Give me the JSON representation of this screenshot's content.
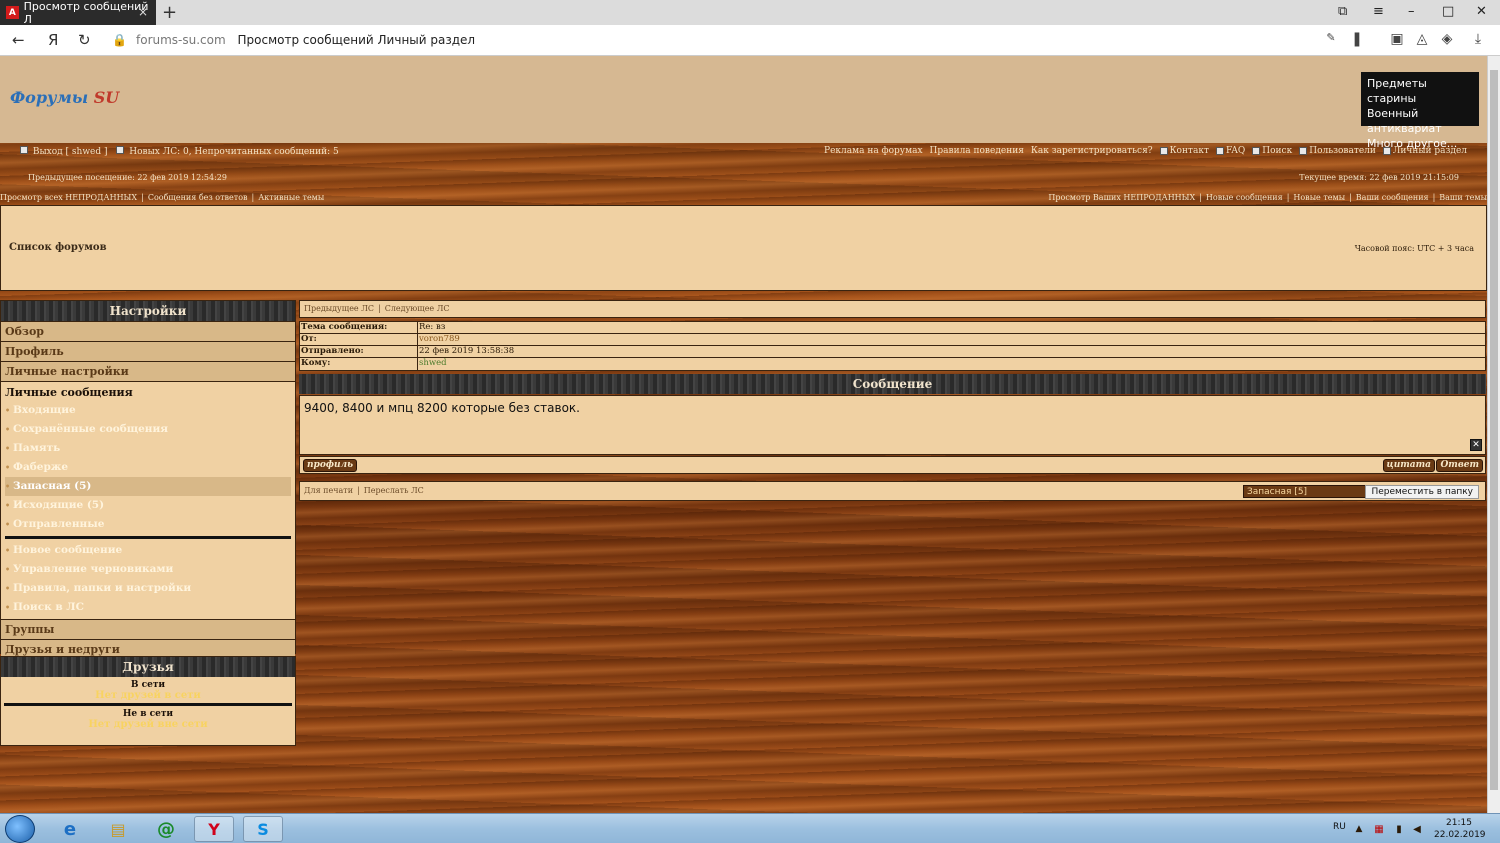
{
  "browser": {
    "tab_title": "Просмотр сообщений Л",
    "tab_favicon": "А",
    "tab_close": "×",
    "new_tab": "+",
    "domain": "forums-su.com",
    "page_title": "Просмотр сообщений Личный раздел"
  },
  "header": {
    "logo_main": "Форумы",
    "logo_su": "SU",
    "ad_lines": [
      "Предметы старины",
      "Военный антиквариат",
      "Много другое..."
    ]
  },
  "topbar": {
    "userbar": "Выход [ shwed ]",
    "pm_status": "Новых ЛС: 0, Непрочитанных сообщений: 5",
    "links": [
      "Реклама на форумах",
      "Правила поведения",
      "Как зарегистрироваться?",
      "Контакт",
      "FAQ",
      "Поиск",
      "Пользователи",
      "Личный раздел"
    ],
    "last_visit": "Предыдущее посещение: 22 фев 2019 12:54:29",
    "current_time": "Текущее время: 22 фев 2019 21:15:09",
    "sub_left": [
      "Просмотр всех НЕПРОДАННЫХ",
      "Сообщения без ответов",
      "Активные темы"
    ],
    "sub_right": [
      "Просмотр Ваших НЕПРОДАННЫХ",
      "Новые сообщения",
      "Новые темы",
      "Ваши сообщения",
      "Ваши темы"
    ]
  },
  "nav": {
    "forum_list": "Список форумов",
    "timezone": "Часовой пояс: UTC + 3 часа"
  },
  "settings": {
    "title": "Настройки",
    "items": [
      "Обзор",
      "Профиль",
      "Личные настройки"
    ],
    "pm_title": "Личные сообщения",
    "pm_folders": [
      "Входящие",
      "Сохранённые сообщения",
      "Память",
      "Фаберже",
      "Запасная (5)",
      "Исходящие (5)",
      "Отправленные"
    ],
    "pm_actions": [
      "Новое сообщение",
      "Управление черновиками",
      "Правила, папки и настройки",
      "Поиск в ЛС"
    ],
    "bottom_items": [
      "Группы",
      "Друзья и недруги"
    ]
  },
  "friends": {
    "title": "Друзья",
    "online_title": "В сети",
    "online_none": "Нет друзей в сети",
    "offline_title": "Не в сети",
    "offline_none": "Нет друзей вне сети"
  },
  "message": {
    "nav_prev": "Предыдущее ЛС",
    "nav_next": "Следующее ЛС",
    "subject_label": "Тема сообщения:",
    "subject": "Re: вз",
    "from_label": "От:",
    "from": "voron789",
    "sent_label": "Отправлено:",
    "sent": "22 фев 2019 13:58:38",
    "to_label": "Кому:",
    "to": "shwed",
    "header": "Сообщение",
    "body": "9400, 8400 и мпц 8200 которые без ставок.",
    "profile_btn": "профиль",
    "quote_btn": "цитата",
    "reply_btn": "Ответ",
    "print_link": "Для печати",
    "forward_link": "Переслать ЛС",
    "folder_selected": "Запасная [5]",
    "move_btn": "Переместить в папку"
  },
  "taskbar": {
    "lang": "RU",
    "time": "21:15",
    "date": "22.02.2019"
  }
}
